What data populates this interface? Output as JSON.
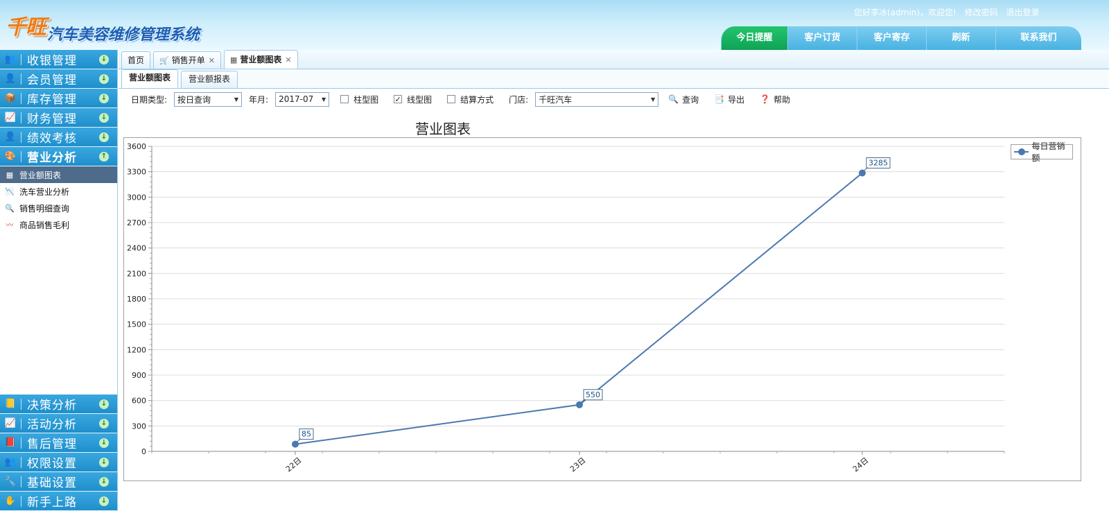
{
  "header": {
    "logo_brand": "千旺",
    "logo_title": "汽车美容维修管理系统",
    "greeting": "您好李冰(admin)，欢迎您!",
    "change_password": "修改密码",
    "logout": "退出登录",
    "nav_tabs": [
      {
        "label": "今日提醒"
      },
      {
        "label": "客户订货"
      },
      {
        "label": "客户寄存"
      },
      {
        "label": "刷新"
      },
      {
        "label": "联系我们"
      }
    ]
  },
  "sidebar": {
    "top_menus": [
      {
        "label": "收银管理",
        "icon": "cashier-icon"
      },
      {
        "label": "会员管理",
        "icon": "member-icon"
      },
      {
        "label": "库存管理",
        "icon": "inventory-icon"
      },
      {
        "label": "财务管理",
        "icon": "finance-icon"
      },
      {
        "label": "绩效考核",
        "icon": "performance-icon"
      },
      {
        "label": "营业分析",
        "icon": "analysis-icon"
      }
    ],
    "sub_items": [
      {
        "label": "营业额图表",
        "icon": "table-icon"
      },
      {
        "label": "洗车营业分析",
        "icon": "chart-icon"
      },
      {
        "label": "销售明细查询",
        "icon": "search-icon"
      },
      {
        "label": "商品销售毛利",
        "icon": "trend-icon"
      }
    ],
    "bottom_menus": [
      {
        "label": "决策分析",
        "icon": "decision-icon"
      },
      {
        "label": "活动分析",
        "icon": "activity-icon"
      },
      {
        "label": "售后管理",
        "icon": "aftersales-icon"
      },
      {
        "label": "权限设置",
        "icon": "permission-icon"
      },
      {
        "label": "基础设置",
        "icon": "settings-icon"
      },
      {
        "label": "新手上路",
        "icon": "guide-icon"
      }
    ]
  },
  "tabs": [
    {
      "label": "首页"
    },
    {
      "label": "销售开单"
    },
    {
      "label": "营业额图表"
    }
  ],
  "subtabs": [
    {
      "label": "营业额图表"
    },
    {
      "label": "营业额报表"
    }
  ],
  "toolbar": {
    "date_type_label": "日期类型:",
    "date_type_value": "按日查询",
    "year_month_label": "年月:",
    "year_month_value": "2017-07",
    "bar_chart_label": "柱型图",
    "line_chart_label": "线型图",
    "settlement_label": "结算方式",
    "store_label": "门店:",
    "store_value": "千旺汽车",
    "query_label": "查询",
    "export_label": "导出",
    "help_label": "帮助"
  },
  "colors": {
    "series": "#4a78b0",
    "header_active_tab": "#12b460",
    "sidebar_menu": "#2b9ad5"
  },
  "chart_data": {
    "type": "line",
    "title": "营业图表",
    "categories": [
      "22日",
      "23日",
      "24日"
    ],
    "series": [
      {
        "name": "每日营销额",
        "values": [
          85,
          550,
          3285
        ]
      }
    ],
    "ylim": [
      0,
      3600
    ],
    "yticks": [
      0,
      300,
      600,
      900,
      1200,
      1500,
      1800,
      2100,
      2400,
      2700,
      3000,
      3300,
      3600
    ],
    "grid": true,
    "legend": "top-right"
  }
}
